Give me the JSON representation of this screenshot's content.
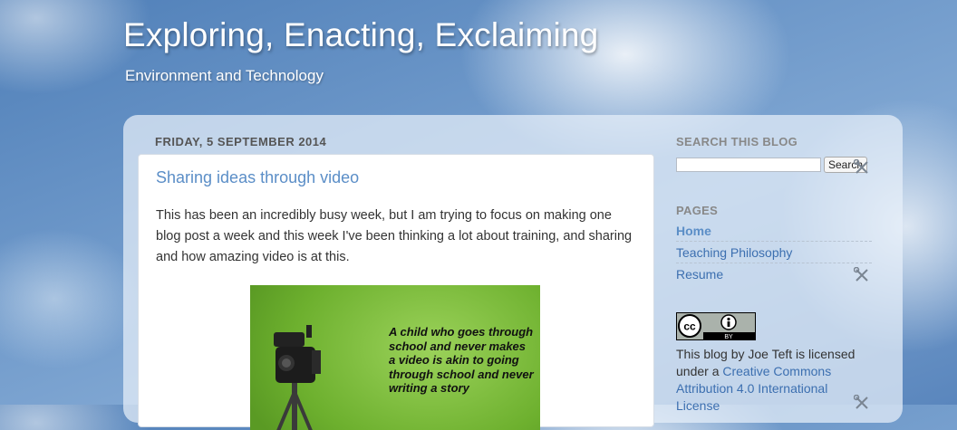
{
  "header": {
    "title": "Exploring, Enacting, Exclaiming",
    "description": "Environment and Technology"
  },
  "post": {
    "date": "Friday, 5 September 2014",
    "title": "Sharing ideas through video",
    "body": "This has been an incredibly busy week, but I am trying to focus on making one blog post a week and this week I've been thinking a lot about training, and sharing and how amazing video is at this.",
    "image_quote": "A child who goes through school and never makes a video is akin to going through school and never writing a story"
  },
  "sidebar": {
    "search_title": "Search This Blog",
    "search_placeholder": "",
    "search_button": "Search",
    "pages_title": "Pages",
    "pages": [
      {
        "label": "Home"
      },
      {
        "label": "Teaching Philosophy"
      },
      {
        "label": "Resume"
      }
    ],
    "license_badge": {
      "cc": "cc",
      "by": "BY"
    },
    "license_prefix": "This blog by Joe Teft is licensed under a ",
    "license_link": "Creative Commons Attribution 4.0 International License"
  },
  "colors": {
    "link": "#3c6fb0",
    "title_link": "#5b8ec7",
    "image_background": "#7cc03a"
  },
  "icons": [
    "wrench-screwdriver-icon",
    "creative-commons-icon",
    "attribution-person-icon"
  ]
}
